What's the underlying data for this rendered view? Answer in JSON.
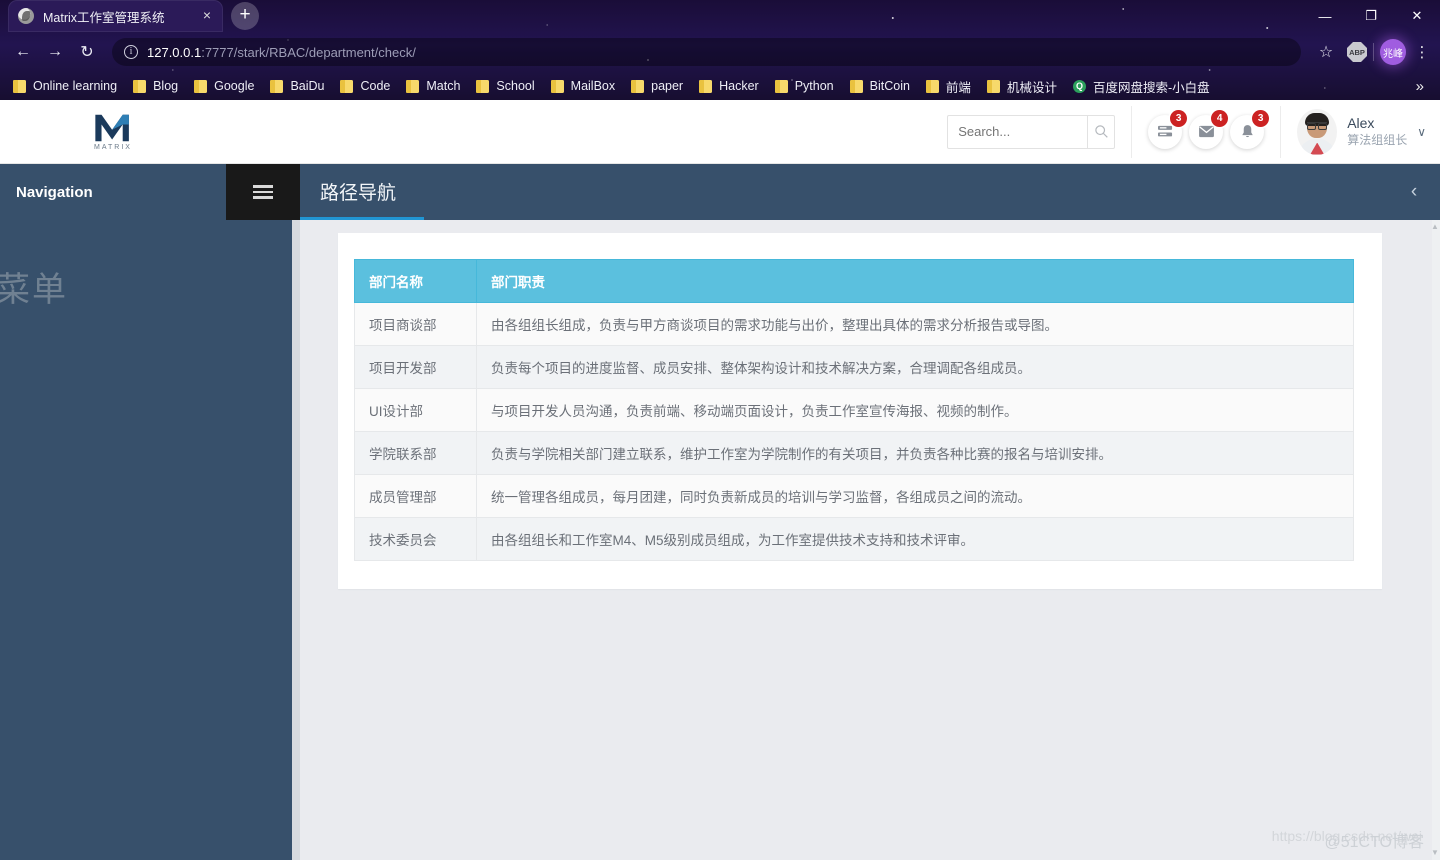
{
  "browser": {
    "tab": {
      "title": "Matrix工作室管理系统",
      "favicon": "globe-icon",
      "close": "×"
    },
    "newtab_label": "+",
    "window_controls": {
      "minimize": "—",
      "maximize": "❐",
      "close": "✕"
    },
    "nav": {
      "back": "←",
      "forward": "→",
      "reload": "↻"
    },
    "omnibox": {
      "info_icon": "i",
      "url_host": "127.0.0.1",
      "url_rest": ":7777/stark/RBAC/department/check/",
      "star_icon": "☆"
    },
    "extensions": [
      {
        "name": "abp-extension",
        "label": "ABP"
      },
      {
        "name": "profile-avatar",
        "label": "兆峰"
      }
    ],
    "menu_icon": "⋮",
    "bookmarks": [
      {
        "label": "Online learning",
        "icon": "folder-icon"
      },
      {
        "label": "Blog",
        "icon": "folder-icon"
      },
      {
        "label": "Google",
        "icon": "folder-icon"
      },
      {
        "label": "BaiDu",
        "icon": "folder-icon"
      },
      {
        "label": "Code",
        "icon": "folder-icon"
      },
      {
        "label": "Match",
        "icon": "folder-icon"
      },
      {
        "label": "School",
        "icon": "folder-icon"
      },
      {
        "label": "MailBox",
        "icon": "folder-icon"
      },
      {
        "label": "paper",
        "icon": "folder-icon"
      },
      {
        "label": "Hacker",
        "icon": "folder-icon"
      },
      {
        "label": "Python",
        "icon": "folder-icon"
      },
      {
        "label": "BitCoin",
        "icon": "folder-icon"
      },
      {
        "label": "前端",
        "icon": "folder-icon"
      },
      {
        "label": "机械设计",
        "icon": "folder-icon"
      },
      {
        "label": "百度网盘搜索-小白盘",
        "icon": "baidu-icon"
      }
    ],
    "bookmarks_overflow": "»"
  },
  "app": {
    "brand": {
      "logo": "matrix-m-logo",
      "text": "MATRIX"
    },
    "search": {
      "placeholder": "Search...",
      "value": "",
      "icon": "search-icon"
    },
    "header_icons": [
      {
        "name": "tasks-icon",
        "badge": "3"
      },
      {
        "name": "messages-icon",
        "badge": "4"
      },
      {
        "name": "notifications-icon",
        "badge": "3"
      }
    ],
    "user": {
      "name": "Alex",
      "role": "算法组组长",
      "caret": "∨",
      "avatar": "user-avatar"
    },
    "nav": {
      "title": "Navigation",
      "hamburger": "hamburger-icon",
      "breadcrumb": "路径导航",
      "collapse": "‹"
    },
    "sidebar": {
      "ghost_label": "菜单"
    },
    "accent_colors": {
      "navbar": "#37506b",
      "breadcrumb_underline": "#2196d4",
      "table_header": "#5bc0de",
      "badge": "#cc2222",
      "page_bg": "#eaebef"
    },
    "watermark": {
      "primary": "https://blog.csdn.net/wei",
      "secondary": "@51CTO博客"
    }
  },
  "table": {
    "columns": [
      "部门名称",
      "部门职责"
    ],
    "rows": [
      {
        "name": "项目商谈部",
        "duty": "由各组组长组成，负责与甲方商谈项目的需求功能与出价，整理出具体的需求分析报告或导图。"
      },
      {
        "name": "项目开发部",
        "duty": "负责每个项目的进度监督、成员安排、整体架构设计和技术解决方案，合理调配各组成员。"
      },
      {
        "name": "UI设计部",
        "duty": "与项目开发人员沟通，负责前端、移动端页面设计，负责工作室宣传海报、视频的制作。"
      },
      {
        "name": "学院联系部",
        "duty": "负责与学院相关部门建立联系，维护工作室为学院制作的有关项目，并负责各种比赛的报名与培训安排。"
      },
      {
        "name": "成员管理部",
        "duty": "统一管理各组成员，每月团建，同时负责新成员的培训与学习监督，各组成员之间的流动。"
      },
      {
        "name": "技术委员会",
        "duty": "由各组组长和工作室M4、M5级别成员组成，为工作室提供技术支持和技术评审。"
      }
    ]
  }
}
